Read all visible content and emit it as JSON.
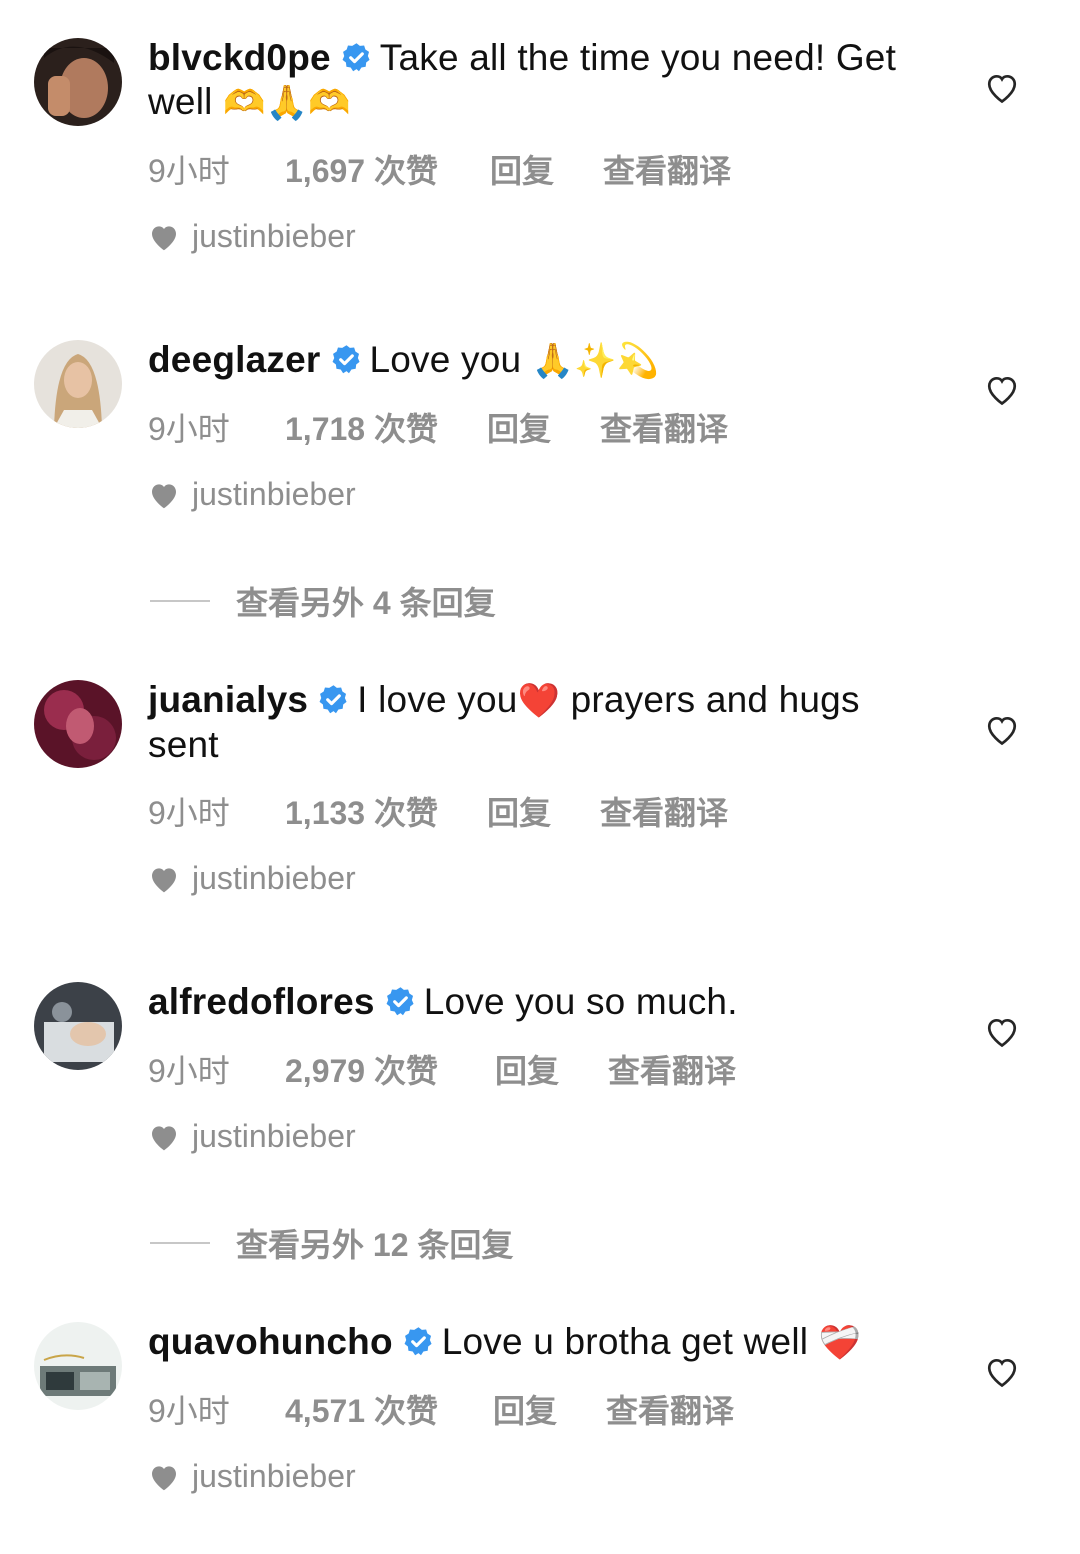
{
  "comments": [
    {
      "username": "blvckd0pe",
      "text": "Take all the time you need! Get well",
      "emoji": "🫶🙏🫶",
      "time": "9小时",
      "likes": "1,697 次赞",
      "reply": "回复",
      "translate": "查看翻译",
      "liked_by": "justinbieber",
      "avatar_color": "#3a2a24"
    },
    {
      "username": "deeglazer",
      "text": "Love you",
      "emoji": "🙏✨💫",
      "time": "9小时",
      "likes": "1,718 次赞",
      "reply": "回复",
      "translate": "查看翻译",
      "liked_by": "justinbieber",
      "avatar_color": "#c9b08e"
    },
    {
      "username": "juanialys",
      "text": "I love you",
      "emoji": "❤️",
      "text_after": "prayers and hugs sent",
      "time": "9小时",
      "likes": "1,133 次赞",
      "reply": "回复",
      "translate": "查看翻译",
      "liked_by": "justinbieber",
      "avatar_color": "#7a1f3c"
    },
    {
      "username": "alfredoflores",
      "text": "Love you so much.",
      "emoji": "",
      "time": "9小时",
      "likes": "2,979 次赞",
      "reply": "回复",
      "translate": "查看翻译",
      "liked_by": "justinbieber",
      "avatar_color": "#4a4f57"
    },
    {
      "username": "quavohuncho",
      "text": "Love u brotha get well",
      "emoji": "❤️‍🩹",
      "time": "9小时",
      "likes": "4,571 次赞",
      "reply": "回复",
      "translate": "查看翻译",
      "liked_by": "justinbieber",
      "avatar_color": "#dfe7e4"
    }
  ],
  "view_replies": [
    {
      "label": "查看另外 4 条回复"
    },
    {
      "label": "查看另外 12 条回复"
    }
  ],
  "colors": {
    "verified": "#3897f0",
    "secondary_text": "#8e8e8e",
    "divider": "#c7c7c7"
  }
}
